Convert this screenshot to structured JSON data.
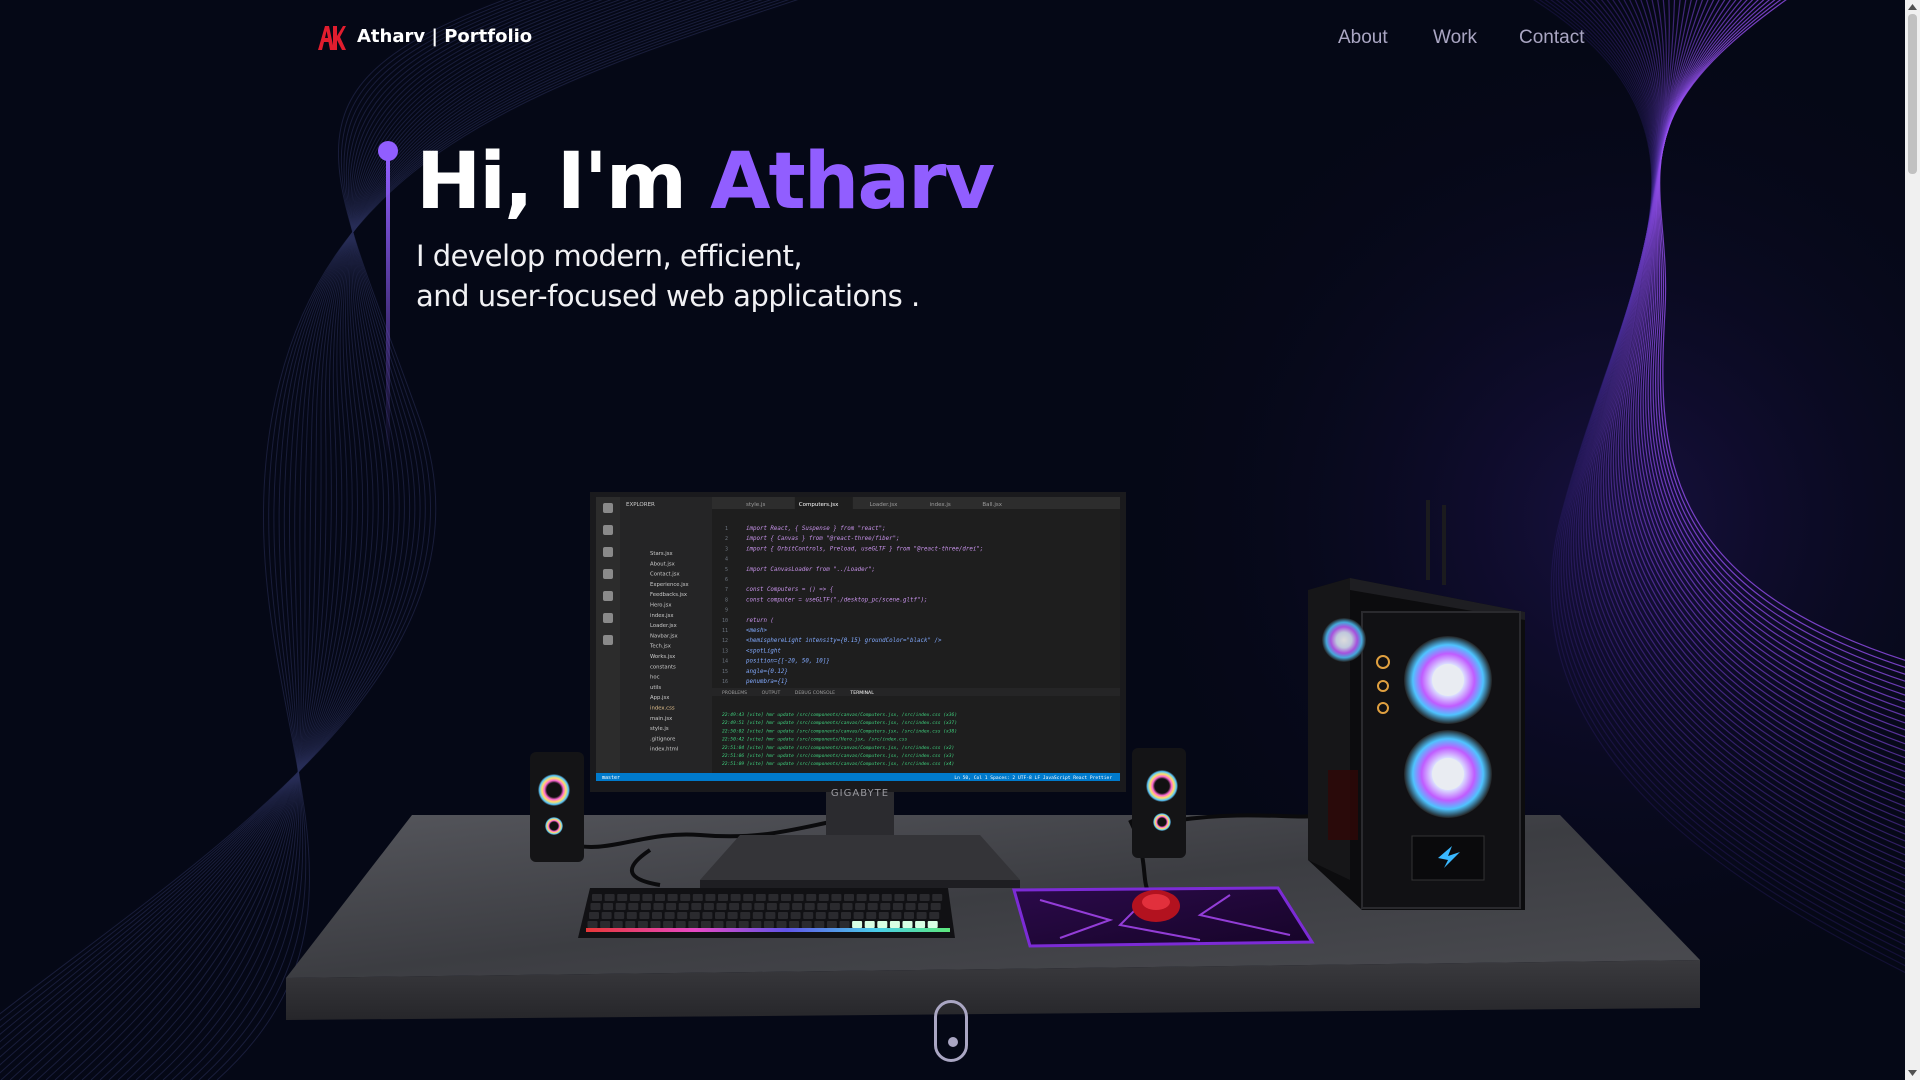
{
  "brand": {
    "logo_initials": "AK",
    "name": "Atharv | Portfolio",
    "logo_color": "#e11d2e"
  },
  "nav": {
    "links": [
      "About",
      "Work",
      "Contact"
    ]
  },
  "hero": {
    "greeting": "Hi, I'm ",
    "name": "Atharv",
    "subtitle_line1": "I develop modern, efficient,",
    "subtitle_line2": "and user-focused web applications ."
  },
  "scene": {
    "monitor_brand": "GIGABYTE",
    "editor": {
      "tabs": [
        "style.js",
        "Computers.jsx",
        "Loader.jsx",
        "index.js",
        "Ball.jsx"
      ],
      "explorer_title": "EXPLORER",
      "files": [
        "Stars.jsx",
        "About.jsx",
        "Contact.jsx",
        "Experience.jsx",
        "Feedbacks.jsx",
        "Hero.jsx",
        "index.jsx",
        "Loader.jsx",
        "Navbar.jsx",
        "Tech.jsx",
        "Works.jsx",
        "constants",
        "hoc",
        "utils",
        "App.jsx",
        "index.css",
        "main.jsx",
        "style.js",
        ".gitignore",
        "index.html"
      ],
      "code_lines": [
        "import React, { Suspense } from \"react\";",
        "import { Canvas } from \"@react-three/fiber\";",
        "import { OrbitControls, Preload, useGLTF } from \"@react-three/drei\";",
        "",
        "import CanvasLoader from \"../Loader\";",
        "",
        "const Computers = () => {",
        "  const computer = useGLTF(\"./desktop_pc/scene.gltf\");",
        "",
        "  return (",
        "    <mesh>",
        "      <hemisphereLight intensity={0.15} groundColor=\"black\" />",
        "      <spotLight",
        "        position={[-20, 50, 10]}",
        "        angle={0.12}",
        "        penumbra={1}"
      ],
      "panel_tabs": [
        "PROBLEMS",
        "OUTPUT",
        "DEBUG CONSOLE",
        "TERMINAL"
      ],
      "terminal_lines": [
        "22:49:43 [vite] hmr update /src/components/canvas/Computers.jsx, /src/index.css (x36)",
        "22:49:51 [vite] hmr update /src/components/canvas/Computers.jsx, /src/index.css (x37)",
        "22:50:02 [vite] hmr update /src/components/canvas/Computers.jsx, /src/index.css (x38)",
        "22:50:42 [vite] hmr update /src/components/Hero.jsx, /src/index.css",
        "22:51:04 [vite] hmr update /src/components/canvas/Computers.jsx, /src/index.css (x2)",
        "22:51:06 [vite] hmr update /src/components/canvas/Computers.jsx, /src/index.css (x3)",
        "22:51:09 [vite] hmr update /src/components/canvas/Computers.jsx, /src/index.css (x4)"
      ],
      "status_left": "master",
      "status_right": "Ln 50, Col 1   Spaces: 2   UTF-8   LF   JavaScript React   Prettier"
    }
  },
  "colors": {
    "background": "#050816",
    "accent": "#915eff",
    "nav_text": "#aaa6c3",
    "white": "#ffffff"
  },
  "icons": {
    "logo": "ak-logo-icon",
    "scroll": "mouse-scroll-icon"
  }
}
